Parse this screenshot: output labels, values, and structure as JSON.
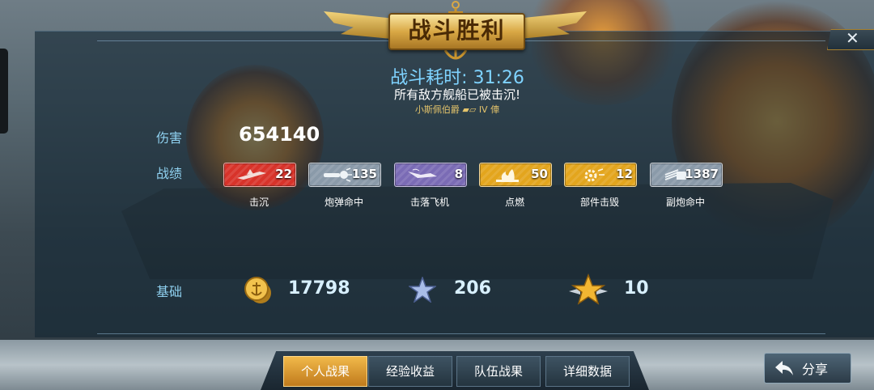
{
  "banner": {
    "title": "战斗胜利",
    "close": "✕"
  },
  "header": {
    "time_label": "战斗耗时: 31:26",
    "message": "所有敌方舰船已被击沉!",
    "ship_info": "小斯佩伯爵 ▰▱ IV 俥"
  },
  "stats": {
    "damage_label": "伤害",
    "damage_value": "654140",
    "record_label": "战绩",
    "badges": [
      {
        "icon": "sunk-ship-icon",
        "value": "22",
        "label": "击沉",
        "color": "#d8332a"
      },
      {
        "icon": "shell-hit-icon",
        "value": "135",
        "label": "炮弹命中",
        "color": "#8a9aa9"
      },
      {
        "icon": "plane-shotdown-icon",
        "value": "8",
        "label": "击落飞机",
        "color": "#7a6bb5"
      },
      {
        "icon": "fire-icon",
        "value": "50",
        "label": "点燃",
        "color": "#e3a51d"
      },
      {
        "icon": "module-destroy-icon",
        "value": "12",
        "label": "部件击毁",
        "color": "#e3a51d"
      },
      {
        "icon": "secondary-gun-icon",
        "value": "1387",
        "label": "副炮命中",
        "color": "#8a9aa9"
      }
    ]
  },
  "basic": {
    "label": "基础",
    "silver": {
      "icon": "anchor-coin-icon",
      "value": "17798"
    },
    "xp": {
      "icon": "blue-star-icon",
      "value": "206"
    },
    "commander_xp": {
      "icon": "gold-star-icon",
      "value": "10"
    }
  },
  "tabs": [
    {
      "label": "个人战果",
      "active": true
    },
    {
      "label": "经验收益",
      "active": false
    },
    {
      "label": "队伍战果",
      "active": false
    },
    {
      "label": "详细数据",
      "active": false
    }
  ],
  "share": {
    "label": "分享",
    "icon": "share-arrow-icon"
  }
}
